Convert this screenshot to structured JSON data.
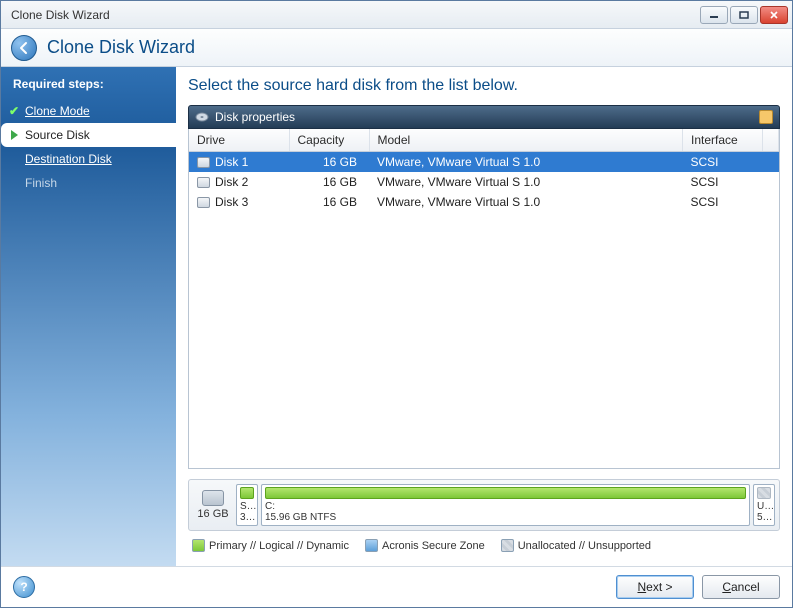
{
  "window": {
    "title": "Clone Disk Wizard"
  },
  "header": {
    "title": "Clone Disk Wizard"
  },
  "sidebar": {
    "heading": "Required steps:",
    "steps": [
      {
        "label": "Clone Mode",
        "state": "done"
      },
      {
        "label": "Source Disk",
        "state": "active"
      },
      {
        "label": "Destination Disk",
        "state": "pending"
      },
      {
        "label": "Finish",
        "state": "disabled"
      }
    ]
  },
  "main": {
    "heading": "Select the source hard disk from the list below.",
    "panel_title": "Disk properties",
    "columns": {
      "drive": "Drive",
      "capacity": "Capacity",
      "model": "Model",
      "interface": "Interface"
    },
    "rows": [
      {
        "drive": "Disk 1",
        "capacity": "16 GB",
        "model": "VMware, VMware Virtual S 1.0",
        "interface": "SCSI",
        "selected": true
      },
      {
        "drive": "Disk 2",
        "capacity": "16 GB",
        "model": "VMware, VMware Virtual S 1.0",
        "interface": "SCSI",
        "selected": false
      },
      {
        "drive": "Disk 3",
        "capacity": "16 GB",
        "model": "VMware, VMware Virtual S 1.0",
        "interface": "SCSI",
        "selected": false
      }
    ],
    "disk_total": "16 GB",
    "partitions": [
      {
        "name": "S…",
        "size": "3…",
        "style": "green",
        "flex": "0 0 22px"
      },
      {
        "name": "C:",
        "size": "15.96 GB  NTFS",
        "style": "green",
        "flex": "1"
      },
      {
        "name": "U…",
        "size": "5…",
        "style": "gray",
        "flex": "0 0 22px"
      }
    ],
    "legend": {
      "primary": "Primary // Logical // Dynamic",
      "acronis": "Acronis Secure Zone",
      "unalloc": "Unallocated // Unsupported"
    }
  },
  "footer": {
    "next": "ext >",
    "cancel": "ancel"
  }
}
